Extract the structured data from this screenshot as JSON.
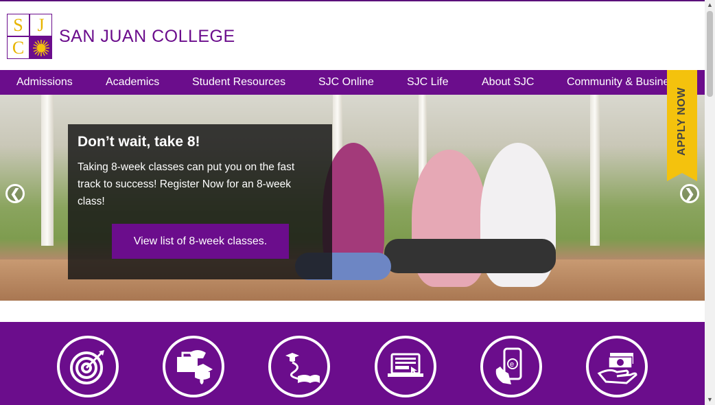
{
  "header": {
    "logo_text": "SAN JUAN COLLEGE",
    "logo_letters": [
      "S",
      "J",
      "C"
    ]
  },
  "nav": {
    "items": [
      "Admissions",
      "Academics",
      "Student Resources",
      "SJC Online",
      "SJC Life",
      "About SJC",
      "Community & Business"
    ]
  },
  "apply": {
    "label": "APPLY NOW"
  },
  "hero": {
    "title": "Don’t wait, take 8!",
    "body": "Taking 8-week classes can put you on the fast track to success! Register Now for an 8-week class!",
    "button": "View list of 8-week classes.",
    "prev": "❮",
    "next": "❯"
  },
  "icons": [
    "target-icon",
    "career-briefcase-graduation-icon",
    "pathway-book-icon",
    "online-laptop-icon",
    "mobile-ebook-icon",
    "money-hand-icon"
  ],
  "colors": {
    "brand_purple": "#6b0d8c",
    "apply_yellow": "#f4c20d"
  }
}
